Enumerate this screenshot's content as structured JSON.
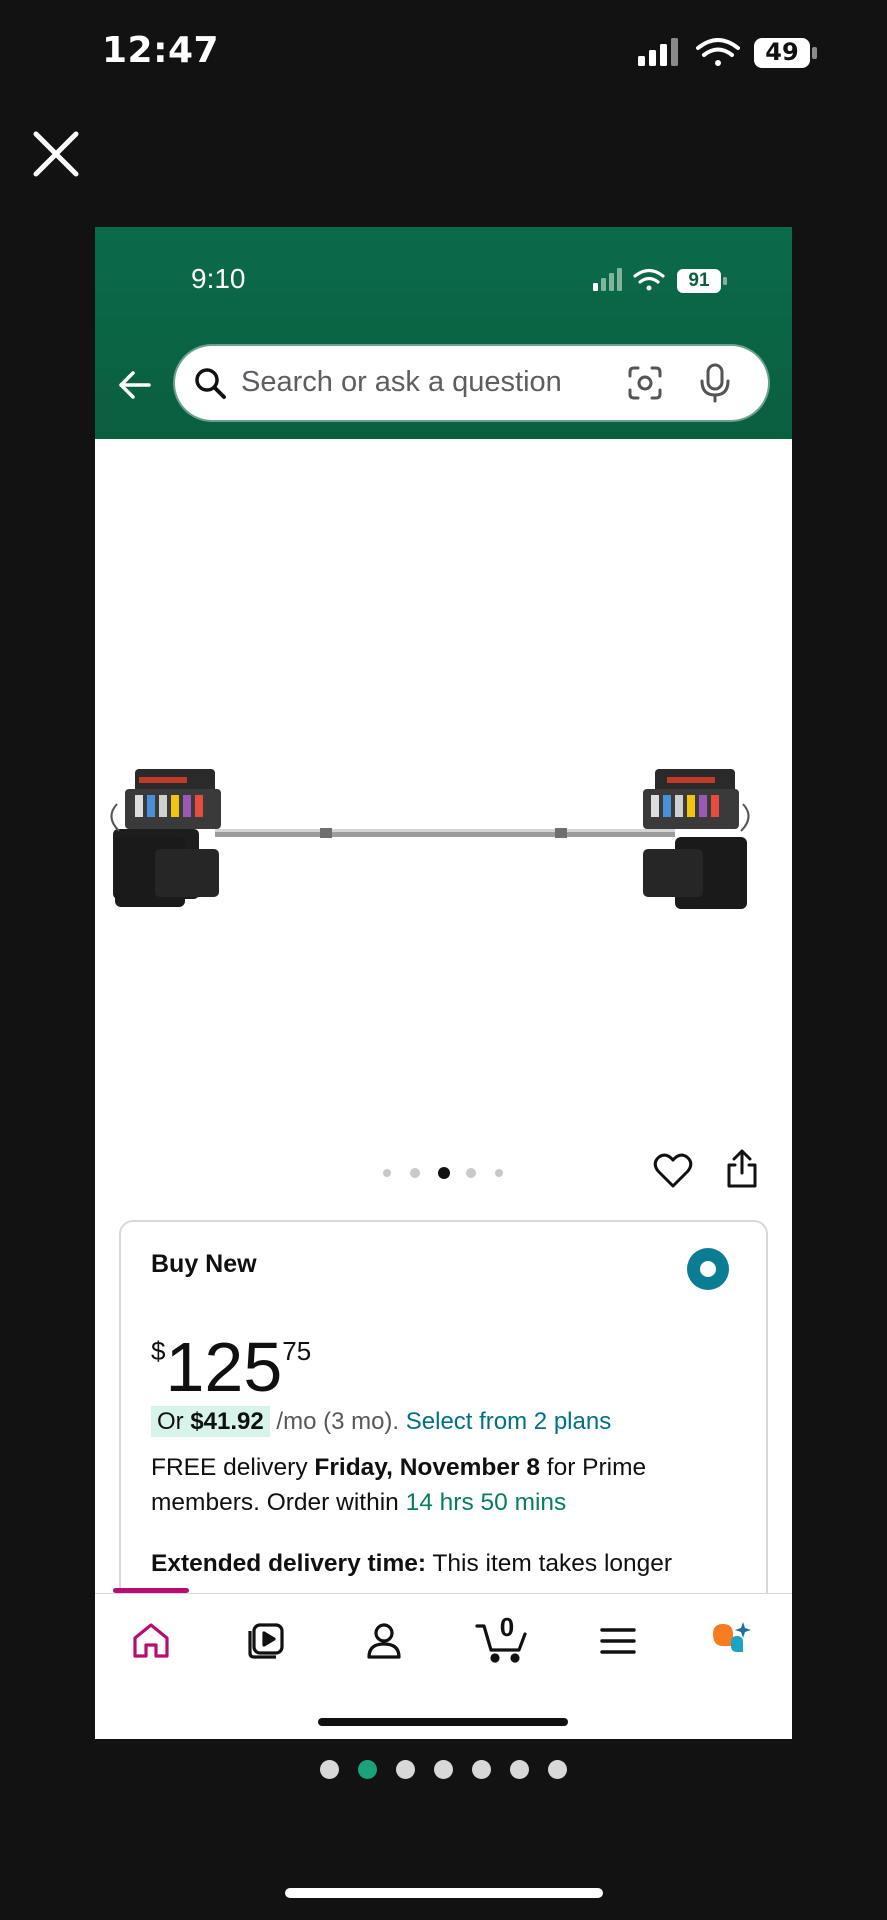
{
  "outer_status": {
    "time": "12:47",
    "battery": "49"
  },
  "inner_status": {
    "time": "9:10",
    "battery": "91"
  },
  "search": {
    "placeholder": "Search or ask a question"
  },
  "image_carousel": {
    "dot_count": 5,
    "active_index": 2
  },
  "buy_box": {
    "title": "Buy New",
    "price": {
      "currency": "$",
      "whole": "125",
      "fraction": "75"
    },
    "installment": {
      "prefix": "Or ",
      "amount": "$41.92",
      "term": " /mo (3 mo). ",
      "link": "Select from 2 plans"
    },
    "delivery": {
      "lead": "FREE delivery ",
      "date": "Friday, November 8",
      "tail": " for Prime members. Order within ",
      "countdown": "14 hrs 50 mins"
    },
    "extended": {
      "label": "Extended delivery time:",
      "text": " This item takes longer"
    }
  },
  "bottom_nav": {
    "cart_count": "0",
    "items": [
      "home",
      "video",
      "account",
      "cart",
      "menu",
      "rufus"
    ]
  },
  "pager": {
    "count": 7,
    "active_index": 1
  },
  "colors": {
    "header_green": "#0b6a4a",
    "link_teal": "#007185",
    "radio_teal": "#0a7d93",
    "nav_accent": "#b80c73",
    "pager_active": "#1aa37a"
  }
}
